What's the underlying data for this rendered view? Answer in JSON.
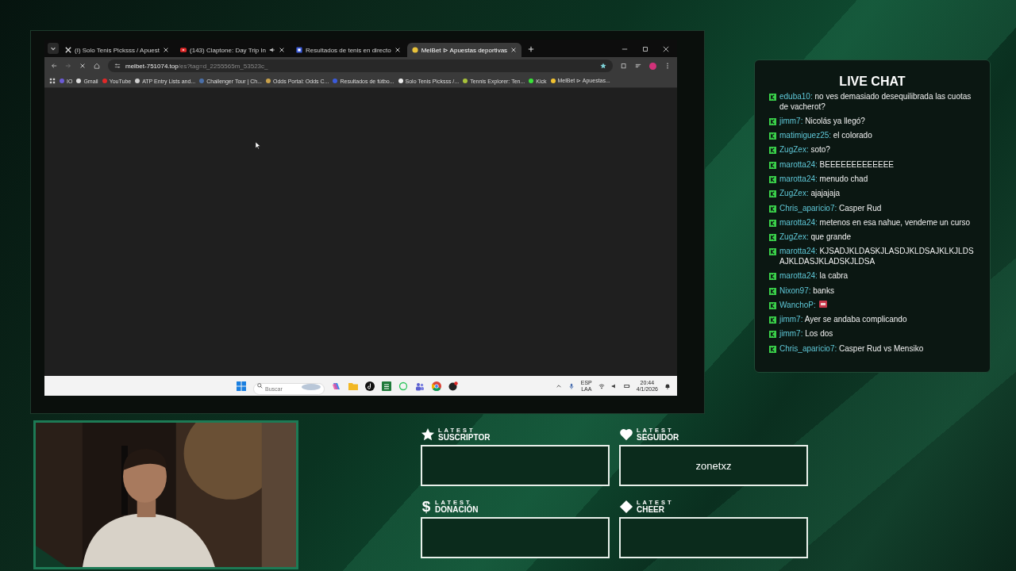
{
  "browser": {
    "tabs": [
      {
        "title": "(I) Solo Tenis Picksss / Apuest",
        "kind": "x",
        "selected": false,
        "audio": false
      },
      {
        "title": "(143) Claptone: Day Trip In",
        "kind": "youtube",
        "selected": false,
        "audio": true
      },
      {
        "title": "Resultados de tenis en directo",
        "kind": "results",
        "selected": false,
        "audio": false
      },
      {
        "title": "MelBet ⊳ Apuestas deportivas",
        "kind": "coin",
        "selected": true,
        "audio": false
      }
    ],
    "url_host": "melbet-751074.top",
    "url_path": "/es?tag=d_2255565m_53523c_",
    "bookmarks": [
      {
        "label": "IO",
        "color": "#6b5bd6"
      },
      {
        "label": "Gmail",
        "color": "#dddddd"
      },
      {
        "label": "YouTube",
        "color": "#e02828"
      },
      {
        "label": "ATP Entry Lists and...",
        "color": "#cfcfcf"
      },
      {
        "label": "Challenger Tour | Ch...",
        "color": "#4a6fa8"
      },
      {
        "label": "Odds Portal: Odds C...",
        "color": "#c9a14a"
      },
      {
        "label": "Resultados de fútbo...",
        "color": "#3b5bdb"
      },
      {
        "label": "Solo Tenis Picksss /...",
        "color": "#eeeeee"
      },
      {
        "label": "Tennis Explorer: Ten...",
        "color": "#a8c23a"
      },
      {
        "label": "Kick",
        "color": "#39e339"
      },
      {
        "label": "MelBet ⊳ Apuestas...",
        "color": "#f2c230"
      }
    ],
    "taskbar": {
      "search_placeholder": "Buscar",
      "lang": "ESP",
      "region": "LAA",
      "time": "20:44",
      "date": "4/1/2026"
    }
  },
  "chat": {
    "title": "LIVE CHAT",
    "messages": [
      {
        "user": "eduba10:",
        "text": "no ves demasiado desequilibrada las cuotas de vacherot?",
        "kind": "text"
      },
      {
        "user": "jimm7:",
        "text": "Nicolás ya llegó?",
        "kind": "text"
      },
      {
        "user": "matimiguez25:",
        "text": "el colorado",
        "kind": "text"
      },
      {
        "user": "ZugZex:",
        "text": "soto?",
        "kind": "text"
      },
      {
        "user": "marotta24:",
        "text": "BEEEEEEEEEEEEE",
        "kind": "text"
      },
      {
        "user": "marotta24:",
        "text": "menudo chad",
        "kind": "text"
      },
      {
        "user": "ZugZex:",
        "text": "ajajajaja",
        "kind": "text"
      },
      {
        "user": "Chris_aparicio7:",
        "text": "Casper Rud",
        "kind": "text"
      },
      {
        "user": "marotta24:",
        "text": "metenos en esa nahue, vendeme un curso",
        "kind": "text"
      },
      {
        "user": "ZugZex:",
        "text": "que grande",
        "kind": "text"
      },
      {
        "user": "marotta24:",
        "text": "KJSADJKLDASKJLASDJKLDSAJKLKJLDSAJKLDASJKLADSKJLDSA",
        "kind": "text"
      },
      {
        "user": "marotta24:",
        "text": "la cabra",
        "kind": "text"
      },
      {
        "user": "Nixon97:",
        "text": "banks",
        "kind": "text"
      },
      {
        "user": "WanchoP:",
        "kind": "emote"
      },
      {
        "user": "jimm7:",
        "text": "Ayer se andaba complicando",
        "kind": "text"
      },
      {
        "user": "jimm7:",
        "text": "Los dos",
        "kind": "text"
      },
      {
        "user": "Chris_aparicio7:",
        "text": "Casper Rud vs Mensiko",
        "kind": "text"
      }
    ]
  },
  "widgets": [
    {
      "kind": "star",
      "top": "LATEST",
      "label": "SUSCRIPTOR"
    },
    {
      "kind": "heart",
      "top": "LATEST",
      "label": "SEGUIDOR",
      "value": "zonetxz"
    },
    {
      "kind": "dollar",
      "symbol": "$",
      "top": "LATEST",
      "label": "DONACIÓN"
    },
    {
      "kind": "diamond",
      "top": "LATEST",
      "label": "CHEER"
    }
  ]
}
